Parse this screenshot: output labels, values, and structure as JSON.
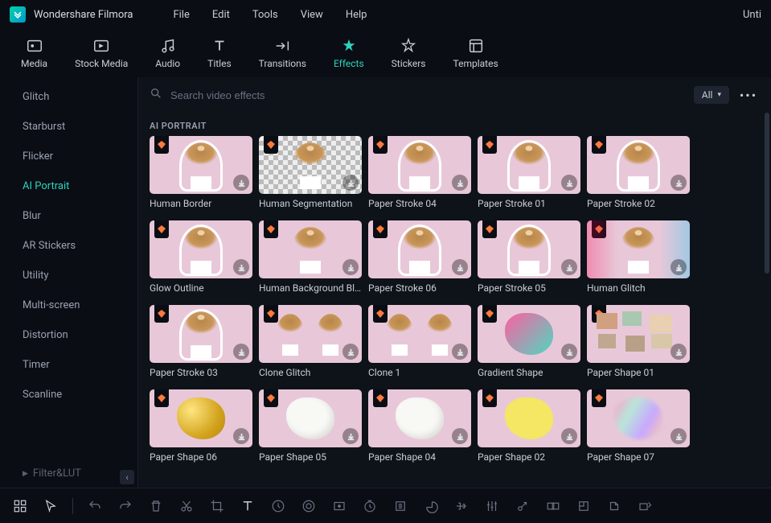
{
  "app": {
    "name": "Wondershare Filmora",
    "doc_title": "Unti"
  },
  "menu": [
    "File",
    "Edit",
    "Tools",
    "View",
    "Help"
  ],
  "toptabs": [
    {
      "label": "Media"
    },
    {
      "label": "Stock Media"
    },
    {
      "label": "Audio"
    },
    {
      "label": "Titles"
    },
    {
      "label": "Transitions"
    },
    {
      "label": "Effects",
      "active": true
    },
    {
      "label": "Stickers"
    },
    {
      "label": "Templates"
    }
  ],
  "sidebar": {
    "items": [
      {
        "label": "Glitch"
      },
      {
        "label": "Starburst"
      },
      {
        "label": "Flicker"
      },
      {
        "label": "AI Portrait",
        "active": true
      },
      {
        "label": "Blur"
      },
      {
        "label": "AR Stickers"
      },
      {
        "label": "Utility"
      },
      {
        "label": "Multi-screen"
      },
      {
        "label": "Distortion"
      },
      {
        "label": "Timer"
      },
      {
        "label": "Scanline"
      }
    ],
    "group2": "Filter&LUT"
  },
  "search": {
    "placeholder": "Search video effects",
    "filter_label": "All"
  },
  "section": {
    "title": "AI PORTRAIT"
  },
  "effects": [
    {
      "label": "Human Border",
      "visual": "pink",
      "fig": "border"
    },
    {
      "label": "Human Segmentation",
      "visual": "checker",
      "fig": "plain"
    },
    {
      "label": "Paper Stroke 04",
      "visual": "pink",
      "fig": "border"
    },
    {
      "label": "Paper Stroke 01",
      "visual": "pink",
      "fig": "border"
    },
    {
      "label": "Paper Stroke 02",
      "visual": "pink",
      "fig": "border"
    },
    {
      "label": "Glow Outline",
      "visual": "pink",
      "fig": "border"
    },
    {
      "label": "Human Background Bl...",
      "visual": "pink",
      "fig": "plain"
    },
    {
      "label": "Paper Stroke 06",
      "visual": "pink",
      "fig": "border"
    },
    {
      "label": "Paper Stroke 05",
      "visual": "pink",
      "fig": "border"
    },
    {
      "label": "Human Glitch",
      "visual": "pink",
      "fig": "glitch"
    },
    {
      "label": "Paper Stroke 03",
      "visual": "pink",
      "fig": "border"
    },
    {
      "label": "Clone Glitch",
      "visual": "pink",
      "fig": "multi"
    },
    {
      "label": "Clone 1",
      "visual": "pink",
      "fig": "multi"
    },
    {
      "label": "Gradient Shape",
      "visual": "pink",
      "shape": "gradient"
    },
    {
      "label": "Paper Shape 01",
      "visual": "pink",
      "collage": true
    },
    {
      "label": "Paper Shape 06",
      "visual": "pink",
      "shape": "gold"
    },
    {
      "label": "Paper Shape 05",
      "visual": "pink",
      "shape": "white"
    },
    {
      "label": "Paper Shape 04",
      "visual": "pink",
      "shape": "white"
    },
    {
      "label": "Paper Shape 02",
      "visual": "pink",
      "shape": "yellow"
    },
    {
      "label": "Paper Shape 07",
      "visual": "pink",
      "shape": "holo"
    }
  ]
}
